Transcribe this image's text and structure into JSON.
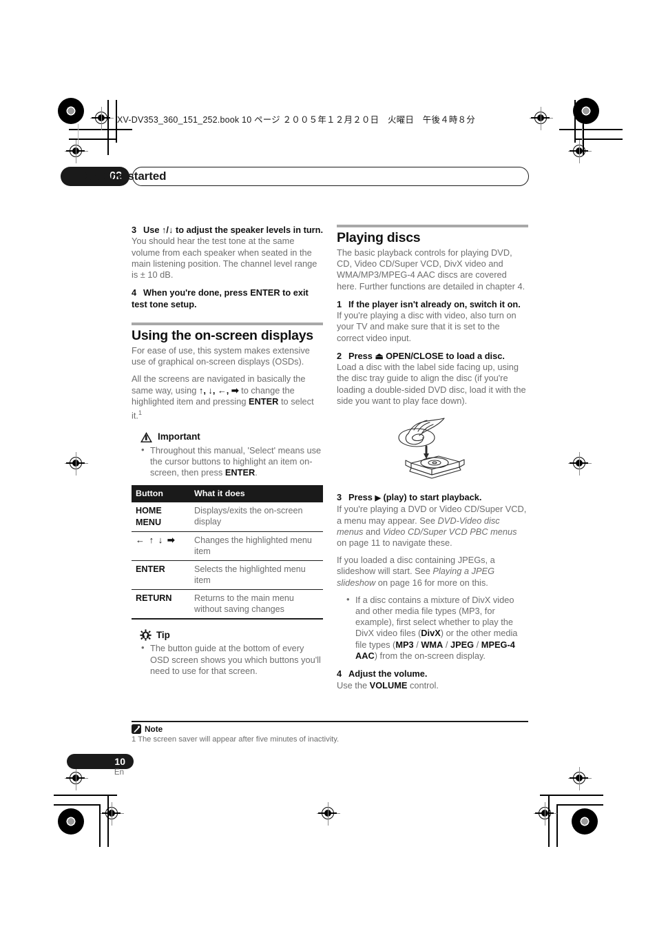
{
  "print_marks": {
    "filename_line": "XV-DV353_360_151_252.book  10 ページ  ２００５年１２月２０日　火曜日　午後４時８分"
  },
  "chapter": {
    "number": "02",
    "title": "Getting started"
  },
  "left_column": {
    "step3": {
      "num": "3",
      "heading_pre": "Use ",
      "heading_arrows": "↑/↓",
      "heading_post": " to adjust the speaker levels in turn.",
      "body": "You should hear the test tone at the same volume from each speaker when seated in the main listening position. The channel level range is ± 10 dB."
    },
    "step4": {
      "num": "4",
      "heading": "When you're done, press ENTER to exit test tone setup."
    },
    "section": {
      "title": "Using the on-screen displays",
      "para1": "For ease of use, this system makes extensive use of graphical on-screen displays (OSDs).",
      "para2_a": "All the screens are navigated in basically the same way, using ",
      "para2_arrows": "↑, ↓, ←, ➡",
      "para2_b": " to change the highlighted item and pressing ",
      "para2_bold": "ENTER",
      "para2_c": " to select it.",
      "para2_footnote": "1"
    },
    "important": {
      "label": "Important",
      "bullet_a": "Throughout this manual, 'Select' means use the cursor buttons to highlight an item on-screen, then press ",
      "bullet_bold": "ENTER",
      "bullet_b": "."
    },
    "button_table": {
      "headers": [
        "Button",
        "What it does"
      ],
      "rows": [
        {
          "button": "HOME MENU",
          "description": "Displays/exits the on-screen display"
        },
        {
          "button": "← ↑ ↓ ➡",
          "description": "Changes the highlighted menu item"
        },
        {
          "button": "ENTER",
          "description": "Selects the highlighted menu item"
        },
        {
          "button": "RETURN",
          "description": "Returns to the main menu without saving changes"
        }
      ]
    },
    "tip": {
      "label": "Tip",
      "bullet": "The button guide at the bottom of every OSD screen shows you which buttons you'll need to use for that screen."
    }
  },
  "right_column": {
    "section": {
      "title": "Playing discs",
      "intro": "The basic playback controls for playing DVD, CD, Video CD/Super VCD, DivX video and WMA/MP3/MPEG-4 AAC discs are covered here. Further functions are detailed in chapter 4."
    },
    "step1": {
      "num": "1",
      "heading": "If the player isn't already on, switch it on.",
      "body": "If you're playing a disc with video, also turn on your TV and make sure that it is set to the correct video input."
    },
    "step2": {
      "num": "2",
      "heading_pre": "Press ",
      "heading_symbol": "⏏",
      "heading_post": " OPEN/CLOSE to load a disc.",
      "body": "Load a disc with the label side facing up, using the disc tray guide to align the disc (if you're loading a double-sided DVD disc, load it with the side you want to play face down)."
    },
    "figure": {
      "caption": "hand-loading-disc-into-tray"
    },
    "step3": {
      "num": "3",
      "heading_pre": "Press ",
      "heading_symbol": "▶",
      "heading_post": " (play) to start playback.",
      "body_a": "If you're playing a DVD or Video CD/Super VCD, a menu may appear. See ",
      "body_italic1": "DVD-Video disc menus",
      "body_b": " and ",
      "body_italic2": "Video CD/Super VCD PBC menus",
      "body_c": " on page 11 to navigate these.",
      "body2_a": "If you loaded a disc containing JPEGs, a slideshow will start. See ",
      "body2_italic": "Playing a JPEG slideshow",
      "body2_b": " on page 16 for more on this.",
      "bullet_a": "If a disc contains a mixture of DivX video and other media file types (MP3, for example), first select whether to play the DivX video files (",
      "bullet_b1": "DivX",
      "bullet_b2": ") or the other media file types (",
      "bullet_b3": "MP3",
      "bullet_sep1": " / ",
      "bullet_b4": "WMA",
      "bullet_sep2": " / ",
      "bullet_b5": "JPEG",
      "bullet_sep3": " / ",
      "bullet_b6": "MPEG-4 AAC",
      "bullet_c": ") from the on-screen display."
    },
    "step4": {
      "num": "4",
      "heading": "Adjust the volume.",
      "body_a": "Use the ",
      "body_bold": "VOLUME",
      "body_b": " control."
    }
  },
  "footer": {
    "note_label": "Note",
    "note_text": "1 The screen saver will appear after five minutes of inactivity.",
    "page_number": "10",
    "language": "En"
  }
}
